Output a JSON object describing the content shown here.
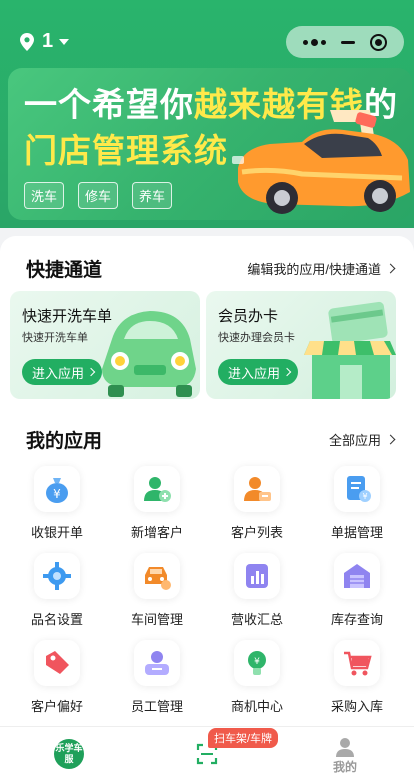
{
  "header": {
    "location_number": "1",
    "capsule": {
      "more_icon": "more-dots-icon",
      "minimize_icon": "minimize-icon",
      "close_icon": "target-close-icon"
    }
  },
  "banner": {
    "line1_white_a": "一个希望你",
    "line1_yellow": "越来越有钱",
    "line1_white_b": "的",
    "line2": "门店管理系统",
    "tags": [
      "洗车",
      "修车",
      "养车"
    ]
  },
  "quick": {
    "title": "快捷通道",
    "link": "编辑我的应用/快捷通道",
    "cards": [
      {
        "title": "快速开洗车单",
        "subtitle": "快速开洗车单",
        "button": "进入应用"
      },
      {
        "title": "会员办卡",
        "subtitle": "快速办理会员卡",
        "button": "进入应用"
      }
    ]
  },
  "apps": {
    "title": "我的应用",
    "link": "全部应用",
    "items": [
      {
        "label": "收银开单",
        "icon": "money-bag-icon"
      },
      {
        "label": "新增客户",
        "icon": "add-user-icon"
      },
      {
        "label": "客户列表",
        "icon": "user-list-icon"
      },
      {
        "label": "单据管理",
        "icon": "document-icon"
      },
      {
        "label": "品名设置",
        "icon": "gear-icon"
      },
      {
        "label": "车间管理",
        "icon": "car-repair-icon"
      },
      {
        "label": "营收汇总",
        "icon": "bar-chart-icon"
      },
      {
        "label": "库存查询",
        "icon": "warehouse-icon"
      },
      {
        "label": "客户偏好",
        "icon": "tag-icon"
      },
      {
        "label": "员工管理",
        "icon": "staff-icon"
      },
      {
        "label": "商机中心",
        "icon": "lightbulb-icon"
      },
      {
        "label": "采购入库",
        "icon": "cart-icon"
      }
    ]
  },
  "tabbar": {
    "home_logo": "乐学车服",
    "scan_badge": "扫车架/车牌",
    "mine_label": "我的"
  },
  "colors": {
    "brand_green": "#22ae62",
    "banner_yellow": "#ffe94a",
    "badge_red": "#f05a4b"
  }
}
